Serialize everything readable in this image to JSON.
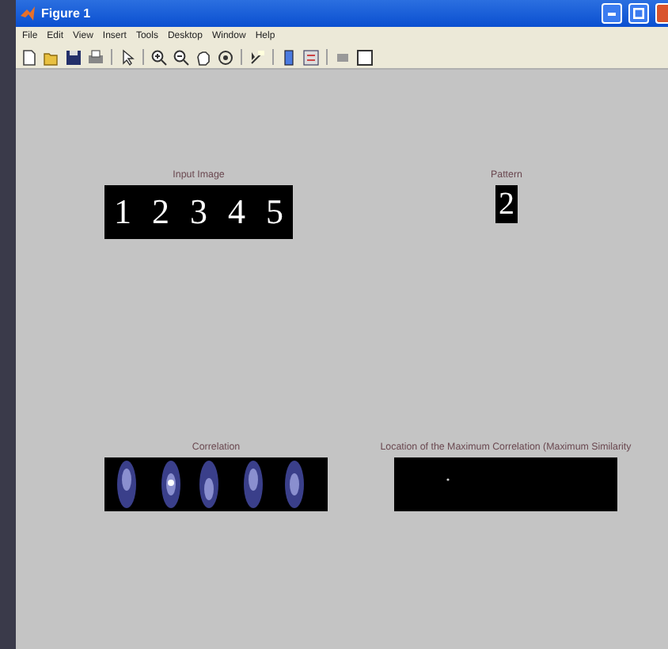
{
  "window": {
    "title": "Figure 1"
  },
  "menu": [
    "File",
    "Edit",
    "View",
    "Insert",
    "Tools",
    "Desktop",
    "Window",
    "Help"
  ],
  "axes": [
    {
      "title": "Input Image",
      "kind": "digits",
      "digits": [
        "1",
        "2",
        "3",
        "4",
        "5"
      ]
    },
    {
      "title": "Pattern",
      "kind": "digits",
      "digits": [
        "2"
      ]
    },
    {
      "title": "Correlation",
      "kind": "picture"
    },
    {
      "title": "Location of the Maximum Correlation (Maximum Similarity",
      "kind": "picture"
    }
  ]
}
